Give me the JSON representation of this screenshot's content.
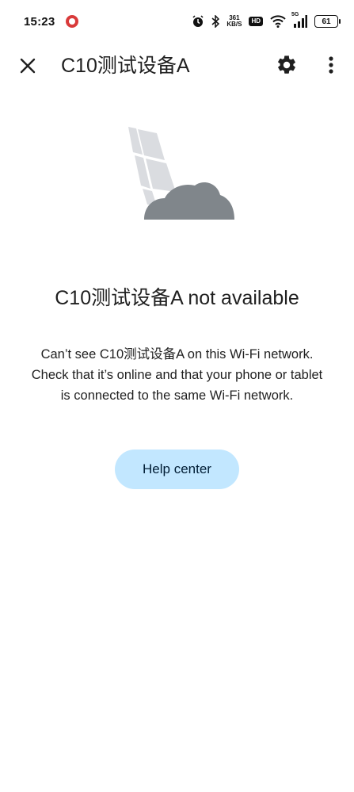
{
  "status_bar": {
    "time": "15:23",
    "net_speed_value": "361",
    "net_speed_unit": "KB/S",
    "hd_label": "HD",
    "signal_label": "5G",
    "battery": "61"
  },
  "app_bar": {
    "title": "C10测试设备A",
    "close_icon": "close-icon",
    "settings_icon": "gear-icon",
    "more_icon": "more-vert-icon"
  },
  "message": {
    "heading": "C10测试设备A not available",
    "body_lines": [
      "Can’t see C10测试设备A on this Wi-Fi network.",
      "Check that it’s online and that your phone or tablet",
      "is connected to the same Wi-Fi network."
    ]
  },
  "actions": {
    "help_label": "Help center"
  },
  "colors": {
    "help_button_bg": "#c2e7ff",
    "illustration_cloud": "#80868b",
    "illustration_panel": "#dadce0"
  }
}
